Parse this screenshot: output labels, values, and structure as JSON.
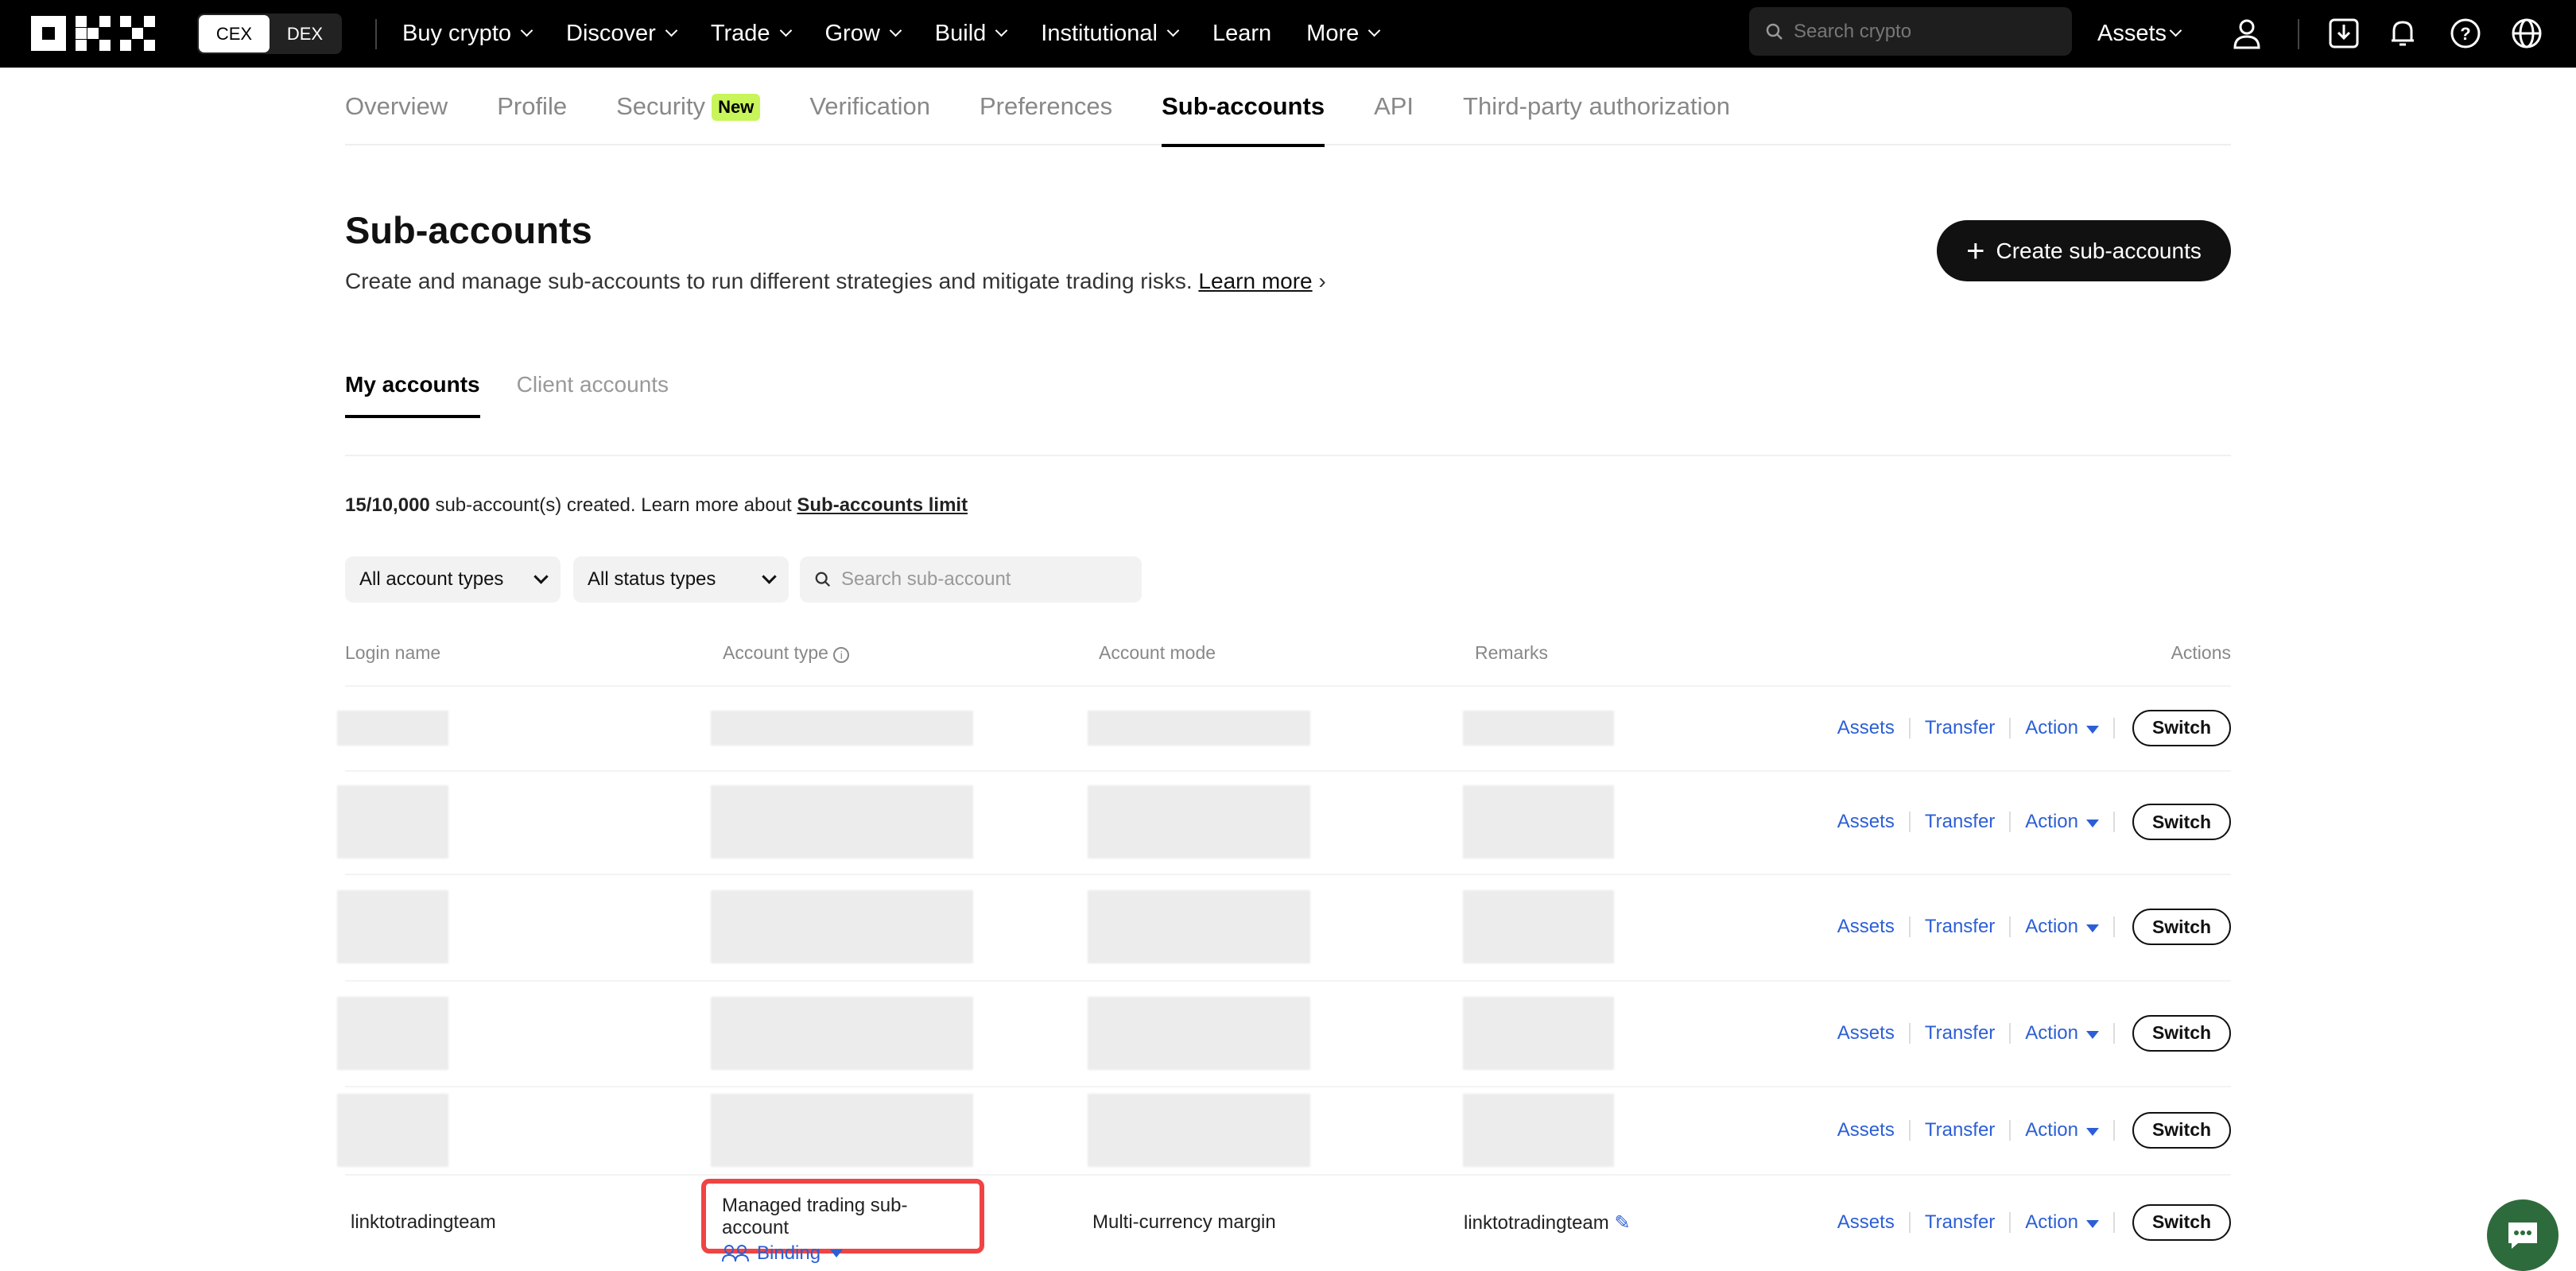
{
  "nav": {
    "cex": "CEX",
    "dex": "DEX",
    "items": [
      "Buy crypto",
      "Discover",
      "Trade",
      "Grow",
      "Build",
      "Institutional",
      "Learn",
      "More"
    ],
    "search_placeholder": "Search crypto",
    "assets": "Assets"
  },
  "subtabs": {
    "items": [
      "Overview",
      "Profile",
      "Security",
      "Verification",
      "Preferences",
      "Sub-accounts",
      "API",
      "Third-party authorization"
    ],
    "security_badge": "New",
    "active": "Sub-accounts"
  },
  "header": {
    "title": "Sub-accounts",
    "description": "Create and manage sub-accounts to run different strategies and mitigate trading risks.",
    "learn_more": "Learn more",
    "create_button": "Create sub-accounts"
  },
  "account_tabs": {
    "items": [
      "My accounts",
      "Client accounts"
    ],
    "active": "My accounts"
  },
  "limit": {
    "count": "15/10,000",
    "text": "sub-account(s) created. Learn more about",
    "link": "Sub-accounts limit"
  },
  "filters": {
    "account_types": "All account types",
    "status_types": "All status types",
    "search_placeholder": "Search sub-account"
  },
  "table": {
    "headers": [
      "Login name",
      "Account type",
      "Account mode",
      "Remarks",
      "Actions"
    ],
    "actions": {
      "assets": "Assets",
      "transfer": "Transfer",
      "action": "Action",
      "switch": "Switch"
    },
    "last_row": {
      "login_name": "linktotradingteam",
      "account_type": "Managed trading sub-account",
      "binding": "Binding",
      "account_mode": "Multi-currency margin",
      "remarks": "linktotradingteam"
    }
  },
  "colors": {
    "accent_link": "#2c5fd6",
    "badge": "#c8f55a",
    "highlight": "#f04444",
    "chat": "#2e6b3c"
  }
}
